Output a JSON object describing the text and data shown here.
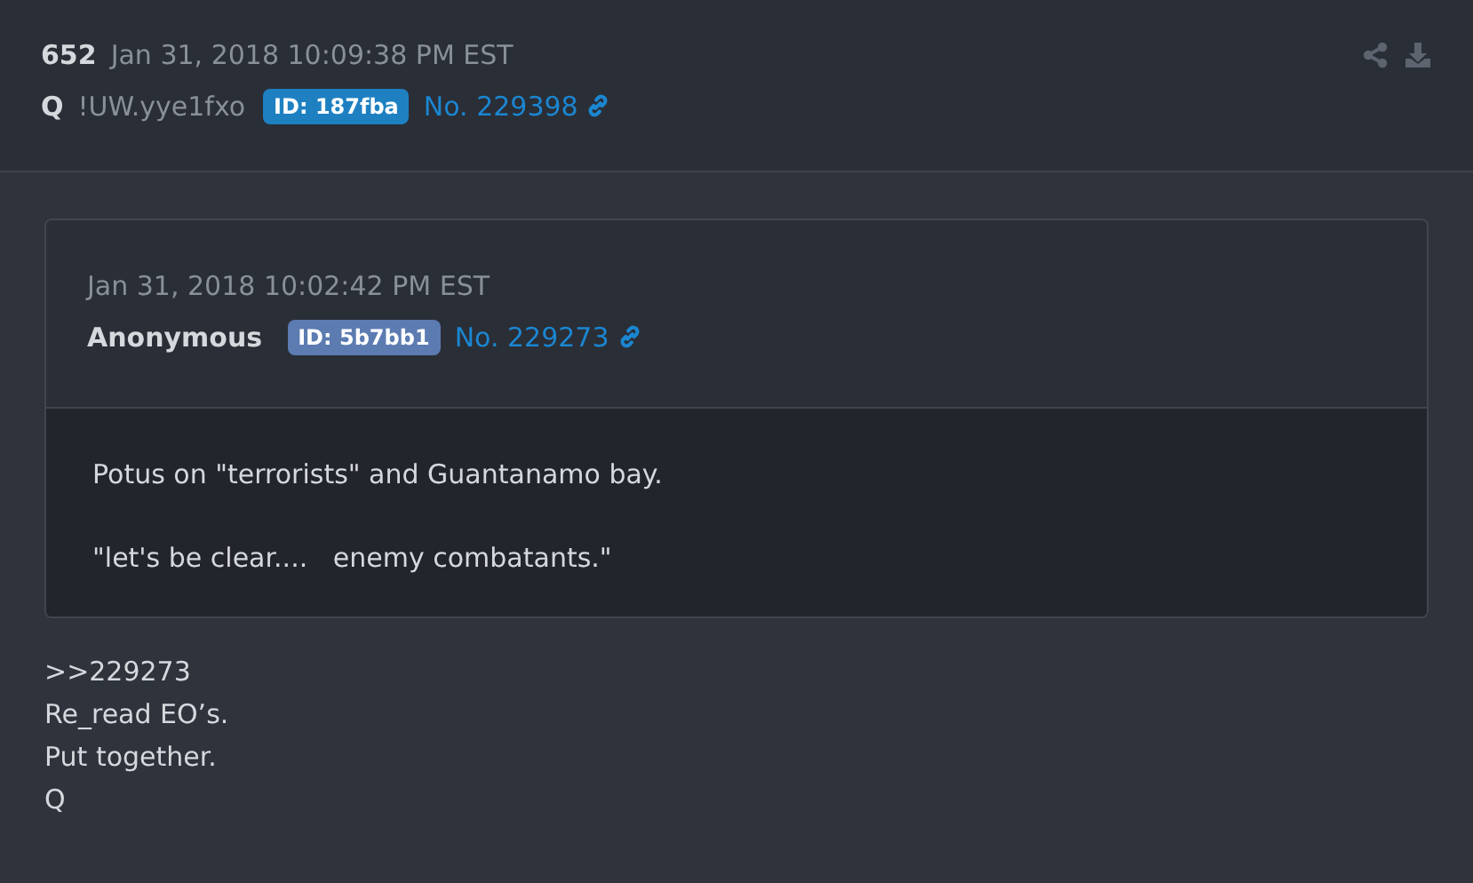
{
  "post": {
    "number": "652",
    "timestamp": "Jan 31, 2018 10:09:38 PM EST",
    "author": "Q",
    "tripcode": "!UW.yye1fxo",
    "id_badge": {
      "text": "ID: 187fba",
      "color": "#1e80c1"
    },
    "post_link": "No. 229398"
  },
  "quoted_post": {
    "timestamp": "Jan 31, 2018 10:02:42 PM EST",
    "author": "Anonymous",
    "id_badge": {
      "text": "ID: 5b7bb1",
      "color": "#5b7bb1"
    },
    "post_link": "No. 229273",
    "lines": [
      "Potus on \"terrorists\" and Guantanamo bay.",
      "\"let's be clear....   enemy combatants.\""
    ]
  },
  "body_lines": [
    ">>229273",
    "Re_read EO’s.",
    "Put together.",
    "Q"
  ]
}
